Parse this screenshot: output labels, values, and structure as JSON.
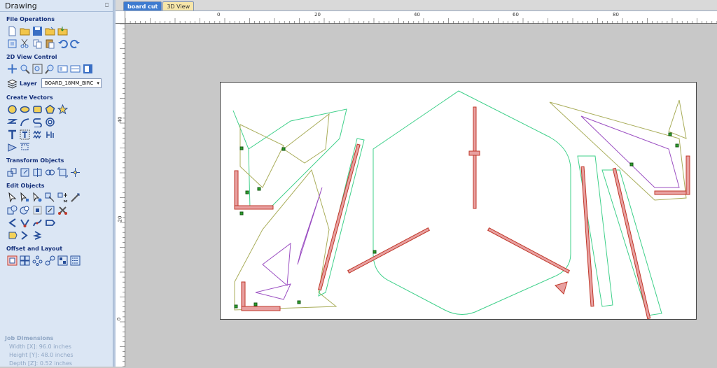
{
  "panel": {
    "title": "Drawing",
    "sections": {
      "file_operations": "File Operations",
      "view_control": "2D View Control",
      "create_vectors": "Create Vectors",
      "transform_objects": "Transform Objects",
      "edit_objects": "Edit Objects",
      "offset_layout": "Offset and Layout"
    },
    "layer": {
      "label": "Layer",
      "value": "BOARD_18MM_BIRC"
    },
    "job_dimensions": {
      "title": "Job Dimensions",
      "width": "Width  [X]: 96.0 inches",
      "height": "Height [Y]: 48.0 inches",
      "depth": "Depth  [Z]: 0.52 inches"
    }
  },
  "tabs": [
    {
      "label": "board cut",
      "active": true
    },
    {
      "label": "3D View",
      "active": false
    }
  ],
  "rulers": {
    "top": [
      "0",
      "20",
      "40",
      "60",
      "80"
    ],
    "left": [
      "40",
      "20",
      "0"
    ]
  },
  "colors": {
    "panel_bg": "#dbe6f4",
    "toolpath_green": "#3fd08a",
    "toolpath_olive": "#a9ad5a",
    "toolpath_purple": "#9b4fc2",
    "board_outline": "#c0392b",
    "board_fill": "#e8a0a0",
    "tab_active": "#3e7bd0",
    "tab_3d": "#f7e6a9"
  },
  "icons": {
    "file_operations": [
      "new-file-icon",
      "open-file-icon",
      "save-icon",
      "open-folder-icon",
      "import-icon",
      "fit-icon",
      "cut-icon",
      "copy-icon",
      "paste-icon",
      "undo-icon",
      "redo-icon"
    ],
    "view_control": [
      "pan-icon",
      "zoom-in-icon",
      "zoom-box-icon",
      "zoom-out-icon",
      "view-mode-a-icon",
      "view-mode-b-icon",
      "view-mode-c-icon"
    ],
    "create_vectors": [
      "circle-icon",
      "ellipse-icon",
      "rectangle-icon",
      "polygon-icon",
      "star-icon",
      "polyline-icon",
      "curve-icon",
      "spiral-icon",
      "spiral-dotted-icon",
      "text-icon",
      "text-on-curve-icon",
      "text-arc-icon",
      "text-block-icon",
      "dimension-icon",
      "offset-icon"
    ],
    "transform_objects": [
      "move-icon",
      "scale-icon",
      "mirror-icon",
      "align-icon",
      "size-icon",
      "center-icon"
    ],
    "edit_objects": [
      "select-icon",
      "node-edit-icon",
      "node-select-icon",
      "interactive-icon",
      "group-icon",
      "measure-icon",
      "weld-icon",
      "subtract-icon",
      "intersect-icon",
      "trim-icon",
      "scissors-icon",
      "smooth-icon",
      "fillet-icon",
      "curve-edit-icon",
      "extend-icon",
      "close-icon",
      "join-icon",
      "spline-icon"
    ],
    "offset_layout": [
      "offset-icon",
      "array-icon",
      "circular-array-icon",
      "nesting-icon",
      "layout-icon",
      "tool-icon"
    ]
  }
}
